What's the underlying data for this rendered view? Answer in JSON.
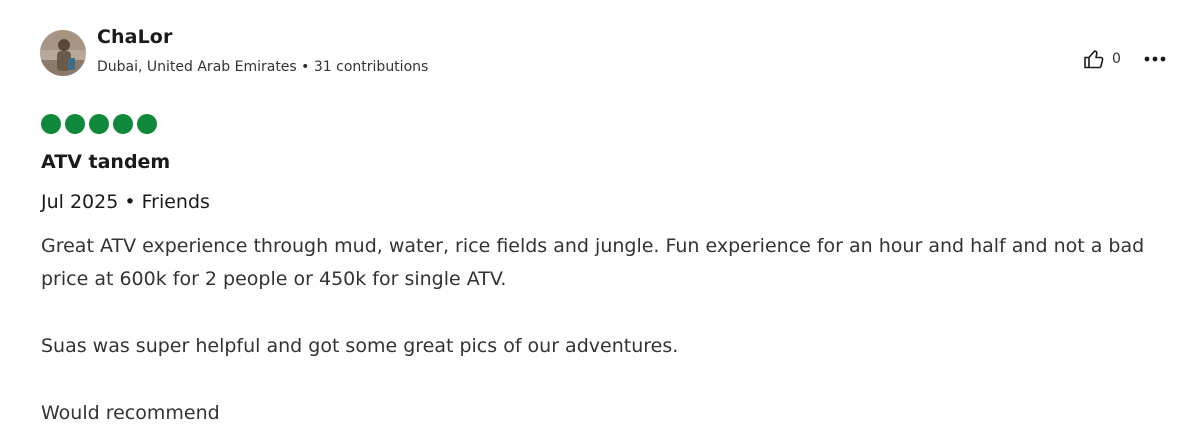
{
  "review": {
    "author": {
      "name": "ChaLor",
      "location": "Dubai, United Arab Emirates",
      "separator": " • ",
      "contributions": "31 contributions"
    },
    "helpful_count": "0",
    "rating": 5,
    "rating_color": "#0f8a3c",
    "title": "ATV tandem",
    "trip_meta": "Jul 2025 • Friends",
    "paragraphs": [
      "Great ATV experience through mud, water, rice fields and jungle. Fun experience for an hour and half and not a bad price at 600k for 2 people or 450k for single ATV.",
      "Suas was super helpful and got some great pics of our adventures.",
      "Would recommend"
    ],
    "icons": {
      "helpful": "thumbs-up-icon",
      "more": "more-options-icon"
    }
  }
}
